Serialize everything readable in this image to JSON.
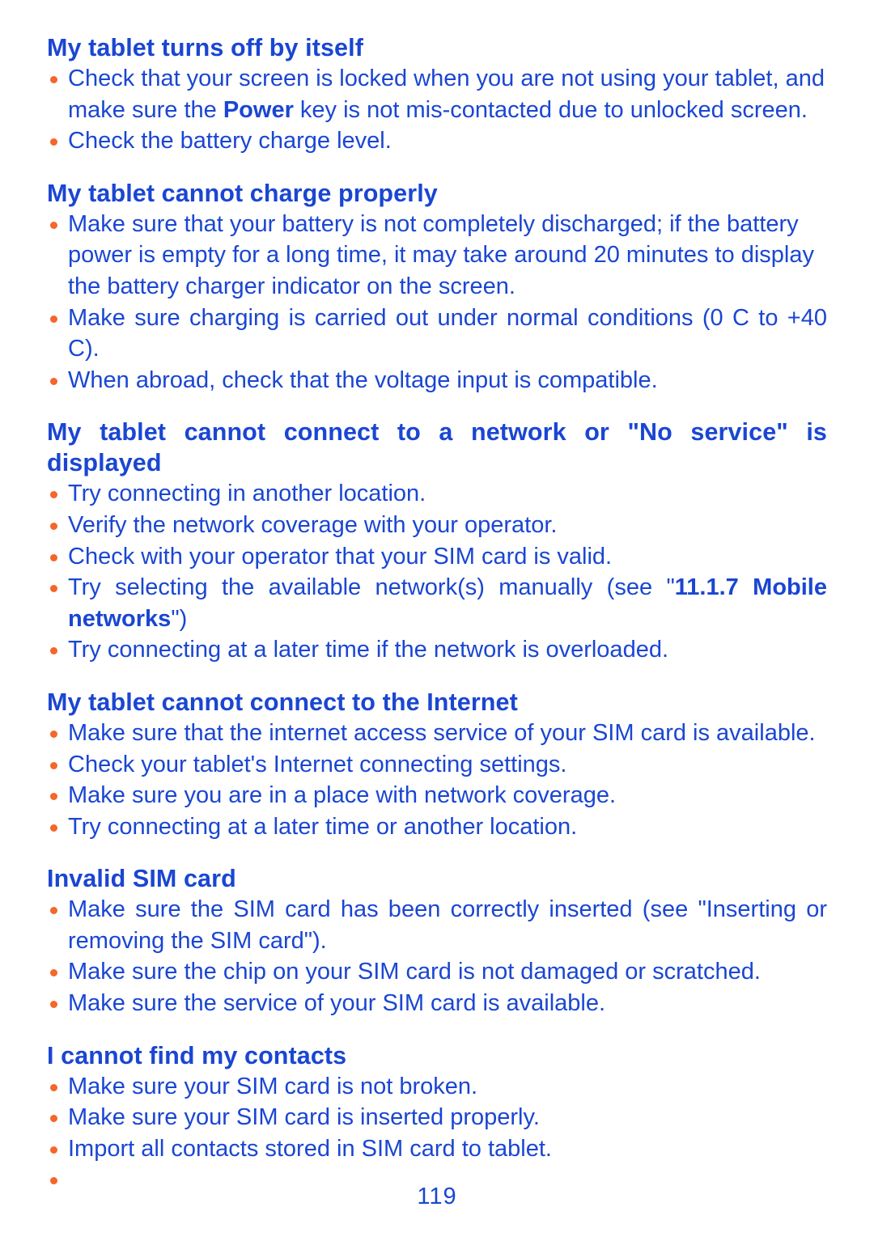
{
  "page": {
    "number": "119",
    "text_color": "#1a46d2",
    "bullet_color": "#f4662a",
    "background": "#ffffff"
  },
  "sections": [
    {
      "heading": "My tablet turns off by itself",
      "bullets": [
        {
          "parts": [
            {
              "text": "Check that your screen is locked when you are not using your tablet, and make sure the ",
              "bold": false
            },
            {
              "text": "Power",
              "bold": true
            },
            {
              "text": " key is not mis-contacted due to unlocked screen.",
              "bold": false
            }
          ]
        },
        {
          "parts": [
            {
              "text": "Check the battery charge level.",
              "bold": false
            }
          ]
        }
      ]
    },
    {
      "heading": "My tablet cannot charge properly",
      "bullets": [
        {
          "parts": [
            {
              "text": "Make sure that your battery is not completely discharged; if the battery power is empty for a long time, it may take around 20 minutes to display the battery charger indicator on the screen.",
              "bold": false
            }
          ]
        },
        {
          "justify": true,
          "parts": [
            {
              "text": "Make sure charging is carried out under normal conditions (0 C to +40 C).",
              "bold": false
            }
          ]
        },
        {
          "parts": [
            {
              "text": "When abroad, check that the voltage input is compatible.",
              "bold": false
            }
          ]
        }
      ]
    },
    {
      "heading": "My tablet cannot connect to a network or \"No service\" is displayed",
      "heading_justify": true,
      "bullets": [
        {
          "parts": [
            {
              "text": "Try connecting in another location.",
              "bold": false
            }
          ]
        },
        {
          "parts": [
            {
              "text": "Verify the network coverage with your operator.",
              "bold": false
            }
          ]
        },
        {
          "parts": [
            {
              "text": "Check with your operator that your SIM card is valid.",
              "bold": false
            }
          ]
        },
        {
          "justify": true,
          "parts": [
            {
              "text": "Try selecting the available network(s) manually (see \"",
              "bold": false
            },
            {
              "text": "11.1.7 Mobile networks",
              "bold": true
            },
            {
              "text": "\")",
              "bold": false
            }
          ]
        },
        {
          "parts": [
            {
              "text": "Try connecting at a later time if the network is overloaded.",
              "bold": false
            }
          ]
        }
      ]
    },
    {
      "heading": "My tablet cannot connect to the Internet",
      "bullets": [
        {
          "parts": [
            {
              "text": "Make sure that the internet access service of your SIM card is available.",
              "bold": false
            }
          ]
        },
        {
          "parts": [
            {
              "text": "Check your tablet's Internet connecting settings.",
              "bold": false
            }
          ]
        },
        {
          "parts": [
            {
              "text": "Make sure you are in a place with network coverage.",
              "bold": false
            }
          ]
        },
        {
          "parts": [
            {
              "text": "Try connecting at a later time or another location.",
              "bold": false
            }
          ]
        }
      ]
    },
    {
      "heading": "Invalid SIM card",
      "bullets": [
        {
          "justify": true,
          "parts": [
            {
              "text": "Make sure the SIM card has been correctly inserted (see \"Inserting or removing the SIM card\").",
              "bold": false
            }
          ]
        },
        {
          "parts": [
            {
              "text": "Make sure the chip on your SIM card is not damaged or scratched.",
              "bold": false
            }
          ]
        },
        {
          "parts": [
            {
              "text": "Make sure the service of your SIM card is available.",
              "bold": false
            }
          ]
        }
      ]
    },
    {
      "heading": "I cannot find my contacts",
      "bullets": [
        {
          "parts": [
            {
              "text": "Make sure your SIM card is not broken.",
              "bold": false
            }
          ]
        },
        {
          "parts": [
            {
              "text": "Make sure your SIM card is inserted properly.",
              "bold": false
            }
          ]
        },
        {
          "parts": [
            {
              "text": "Import all contacts stored in SIM card to tablet.",
              "bold": false
            }
          ]
        },
        {
          "empty": true,
          "parts": []
        }
      ]
    }
  ]
}
